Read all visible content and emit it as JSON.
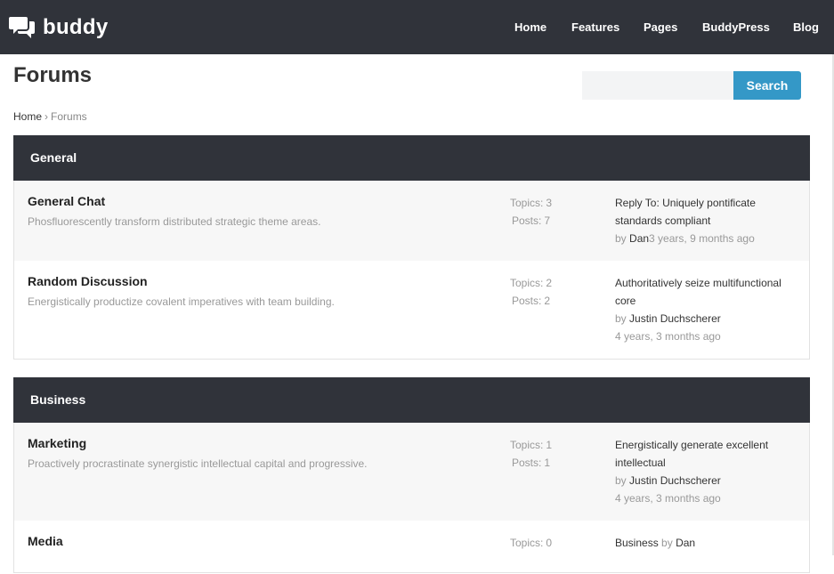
{
  "brand": {
    "name": "buddy"
  },
  "nav": {
    "items": [
      {
        "label": "Home"
      },
      {
        "label": "Features"
      },
      {
        "label": "Pages"
      },
      {
        "label": "BuddyPress"
      },
      {
        "label": "Blog"
      }
    ]
  },
  "page": {
    "title": "Forums"
  },
  "search": {
    "placeholder": "",
    "value": "",
    "button_label": "Search"
  },
  "breadcrumb": {
    "home": "Home",
    "separator": "›",
    "current": "Forums"
  },
  "stat_labels": {
    "topics": "Topics:",
    "posts": "Posts:"
  },
  "groups": [
    {
      "name": "General",
      "forums": [
        {
          "title": "General Chat",
          "description": "Phosfluorescently transform distributed strategic theme areas.",
          "topics": "3",
          "posts": "7",
          "fresh_line1": "Reply To: Uniquely pontificate",
          "fresh_line2": "standards compliant",
          "by": "by",
          "author": "Dan",
          "time": "3 years, 9 months ago"
        },
        {
          "title": "Random Discussion",
          "description": "Energistically productize covalent imperatives with team building.",
          "topics": "2",
          "posts": "2",
          "fresh_line1": "Authoritatively seize multifunctional",
          "fresh_line2": "core",
          "by": "by",
          "author": "Justin Duchscherer",
          "time": "4 years, 3 months ago"
        }
      ]
    },
    {
      "name": "Business",
      "forums": [
        {
          "title": "Marketing",
          "description": "Proactively procrastinate synergistic intellectual capital and progressive.",
          "topics": "1",
          "posts": "1",
          "fresh_line1": "Energistically generate excellent",
          "fresh_line2": "intellectual",
          "by": "by",
          "author": "Justin Duchscherer",
          "time": "4 years, 3 months ago"
        },
        {
          "title": "Media",
          "description": "",
          "topics": "0",
          "fresh_line1": "Business",
          "by": "by",
          "author": "Dan"
        }
      ]
    }
  ],
  "colors": {
    "header_bg": "#30333a",
    "accent": "#3498c7",
    "row_alt": "#f7f7f7"
  },
  "icons": {
    "logo": "speech-bubbles-icon"
  }
}
